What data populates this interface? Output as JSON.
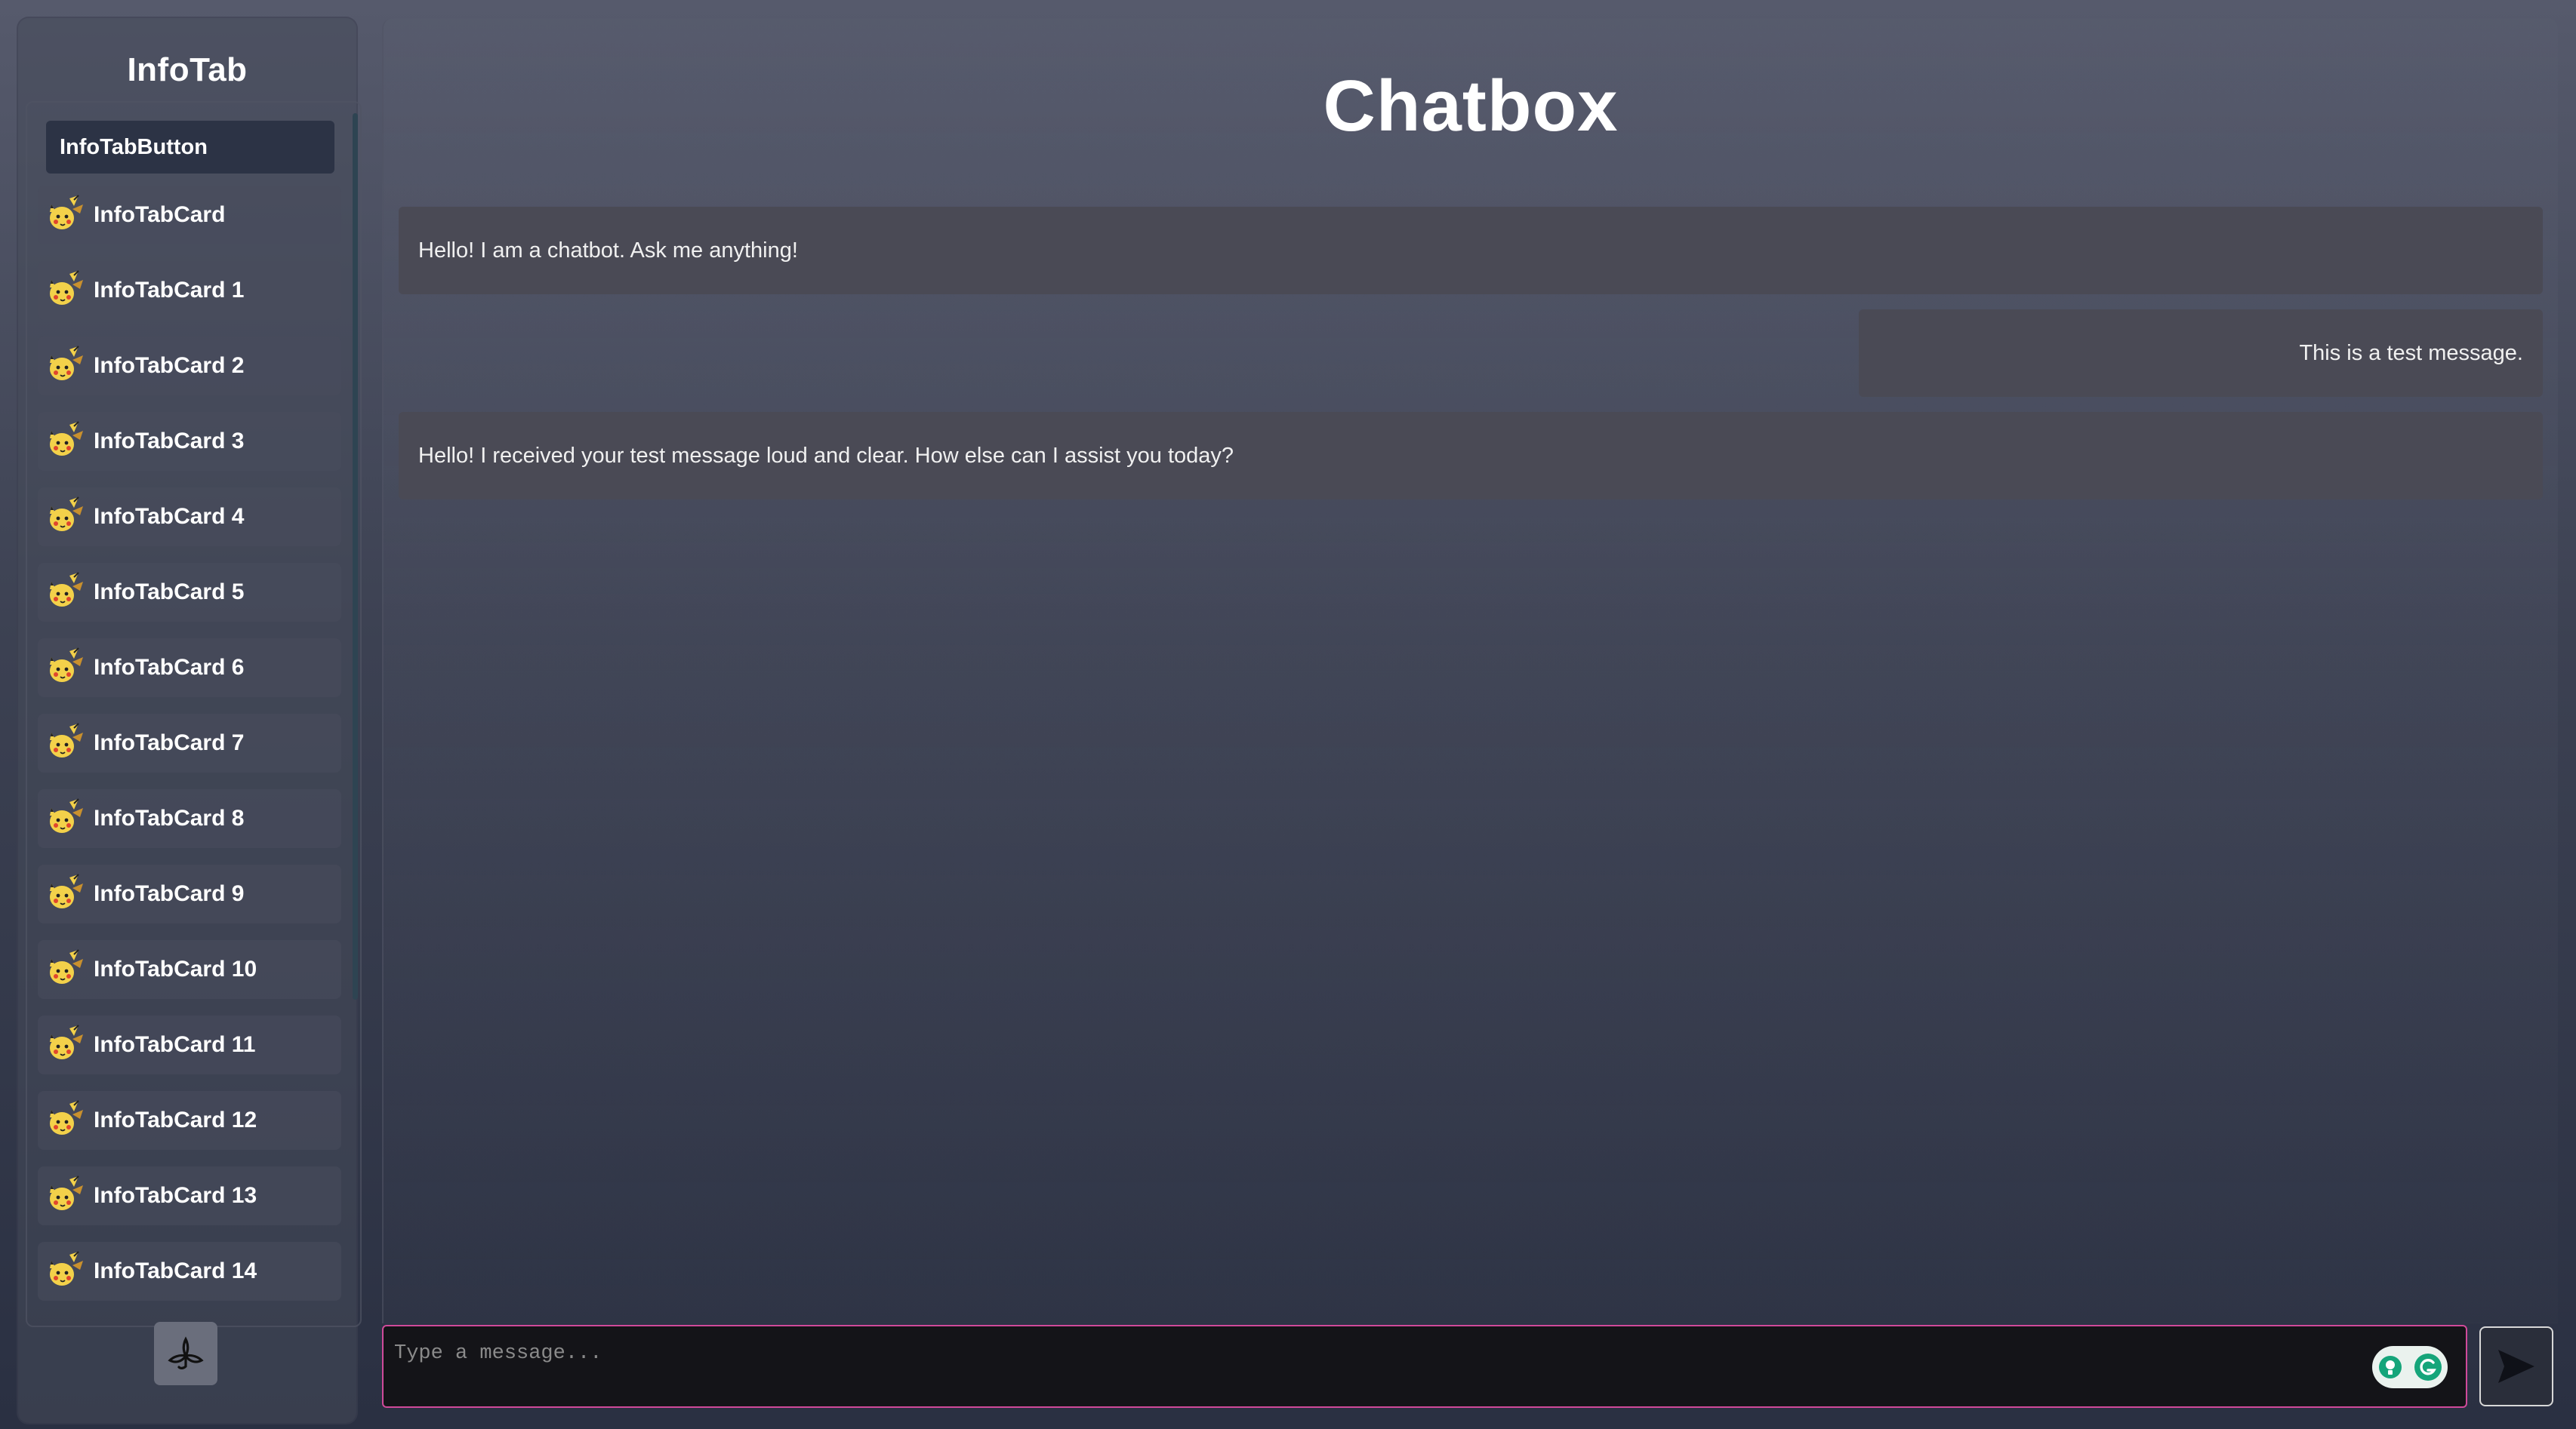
{
  "sidebar": {
    "title": "InfoTab",
    "button_label": "InfoTabButton",
    "cards": [
      {
        "label": "InfoTabCard",
        "icon": "pikachu-icon"
      },
      {
        "label": "InfoTabCard 1",
        "icon": "pikachu-icon"
      },
      {
        "label": "InfoTabCard 2",
        "icon": "pikachu-icon"
      },
      {
        "label": "InfoTabCard 3",
        "icon": "pikachu-icon"
      },
      {
        "label": "InfoTabCard 4",
        "icon": "pikachu-icon"
      },
      {
        "label": "InfoTabCard 5",
        "icon": "pikachu-icon"
      },
      {
        "label": "InfoTabCard 6",
        "icon": "pikachu-icon"
      },
      {
        "label": "InfoTabCard 7",
        "icon": "pikachu-icon"
      },
      {
        "label": "InfoTabCard 8",
        "icon": "pikachu-icon"
      },
      {
        "label": "InfoTabCard 9",
        "icon": "pikachu-icon"
      },
      {
        "label": "InfoTabCard 10",
        "icon": "pikachu-icon"
      },
      {
        "label": "InfoTabCard 11",
        "icon": "pikachu-icon"
      },
      {
        "label": "InfoTabCard 12",
        "icon": "pikachu-icon"
      },
      {
        "label": "InfoTabCard 13",
        "icon": "pikachu-icon"
      },
      {
        "label": "InfoTabCard 14",
        "icon": "pikachu-icon"
      }
    ],
    "settings_icon": "leaf-icon"
  },
  "chat": {
    "title": "Chatbox",
    "messages": [
      {
        "role": "bot",
        "text": "Hello! I am a chatbot. Ask me anything!"
      },
      {
        "role": "user",
        "text": "This is a test message."
      },
      {
        "role": "bot",
        "text": "Hello! I received your test message loud and clear. How else can I assist you today?"
      }
    ]
  },
  "input": {
    "placeholder": "Type a message...",
    "value": ""
  },
  "send": {
    "icon": "send-arrow-icon"
  },
  "colors": {
    "input_border": "#d04a9a",
    "message_bg": "#4a4a55",
    "active_button_bg": "#2c3345"
  }
}
